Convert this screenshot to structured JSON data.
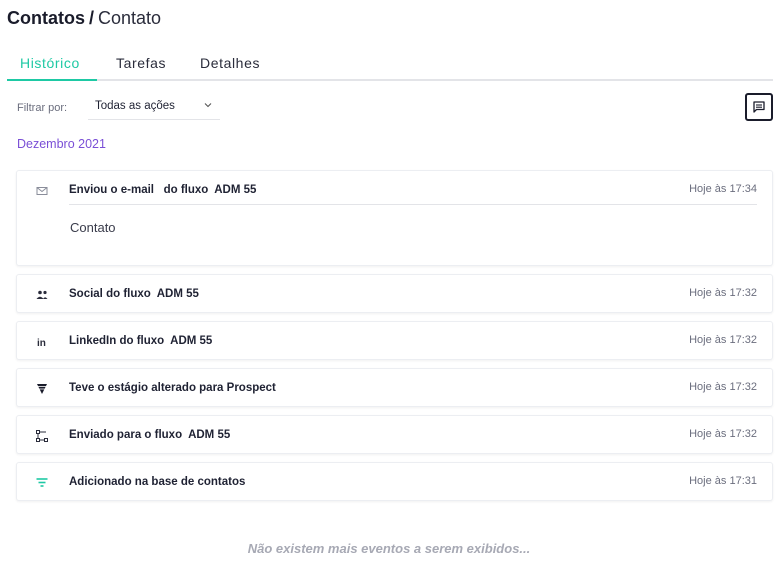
{
  "breadcrumb": {
    "root": "Contatos",
    "separator": "/",
    "current": "Contato"
  },
  "tabs": [
    {
      "label": "Histórico",
      "active": true
    },
    {
      "label": "Tarefas",
      "active": false
    },
    {
      "label": "Detalhes",
      "active": false
    }
  ],
  "filter": {
    "label": "Filtrar por:",
    "value": "Todas as ações"
  },
  "notes_button": {
    "icon": "message-icon"
  },
  "month_header": "Dezembro 2021",
  "events": [
    {
      "icon": "email-icon",
      "title": "Enviou o e-mail   do fluxo  ADM 55",
      "time": "Hoje às 17:34",
      "body": "Contato"
    },
    {
      "icon": "social-icon",
      "title": "Social do fluxo  ADM 55",
      "time": "Hoje às 17:32"
    },
    {
      "icon": "linkedin-icon",
      "title": "LinkedIn do fluxo  ADM 55",
      "time": "Hoje às 17:32"
    },
    {
      "icon": "funnel-icon",
      "title": "Teve o estágio alterado para Prospect",
      "time": "Hoje às 17:32"
    },
    {
      "icon": "flow-icon",
      "title": "Enviado para o fluxo  ADM 55",
      "time": "Hoje às 17:32"
    },
    {
      "icon": "contact-base-icon",
      "title": "Adicionado na base de contatos",
      "time": "Hoje às 17:31"
    }
  ],
  "footer_text": "Não existem mais eventos a serem exibidos...",
  "colors": {
    "accent": "#1ec9a4",
    "month": "#7a4fd6"
  }
}
